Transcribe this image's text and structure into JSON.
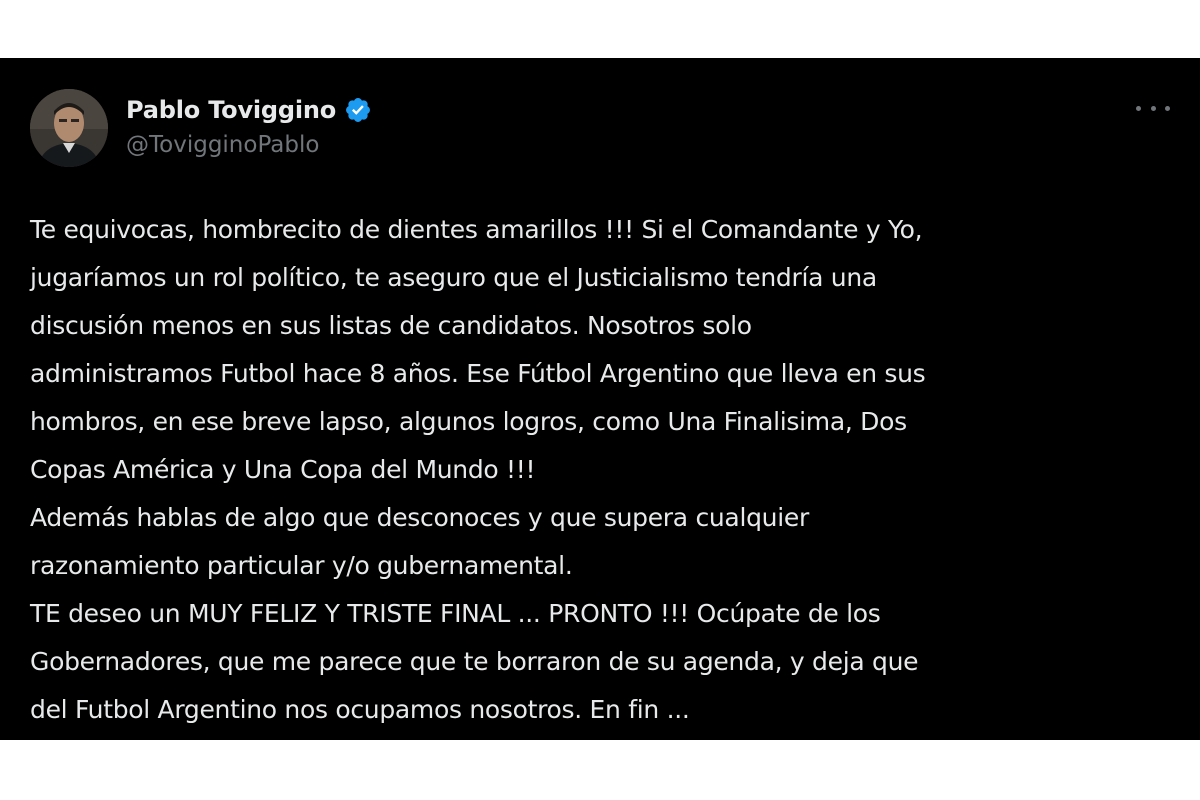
{
  "author": {
    "display_name": "Pablo Toviggino",
    "handle": "@TovigginoPablo",
    "verified_icon": "verified-badge-icon",
    "avatar_icon": "profile-photo"
  },
  "actions": {
    "more_icon": "more-options-icon"
  },
  "colors": {
    "background": "#000000",
    "text_primary": "#e7e9ea",
    "text_secondary": "#71767b",
    "verified": "#1d9bf0"
  },
  "tweet": {
    "lines": [
      "Te equivocas, hombrecito de dientes amarillos !!! Si el Comandante y Yo,",
      "jugaríamos un rol político, te aseguro que el Justicialismo tendría una",
      "discusión menos en sus listas de candidatos. Nosotros solo",
      "administramos Futbol hace 8 años. Ese Fútbol Argentino que lleva en sus",
      "hombros, en ese breve lapso, algunos logros, como Una Finalisima, Dos",
      "Copas América y Una Copa del Mundo !!!",
      "Además hablas de algo que desconoces y que supera cualquier",
      "razonamiento particular y/o gubernamental.",
      "TE deseo un MUY FELIZ Y TRISTE FINAL ... PRONTO !!! Ocúpate de los",
      "Gobernadores, que me parece que te borraron de su agenda, y deja que",
      "del Futbol Argentino nos ocupamos nosotros. En fin ..."
    ]
  }
}
